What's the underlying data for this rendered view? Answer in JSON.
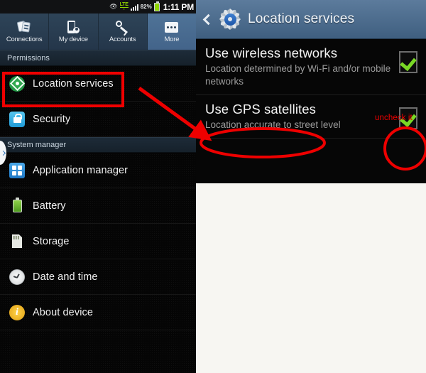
{
  "left_phone": {
    "status_bar": {
      "eye_icon": "eye-icon",
      "network_type": "LTE",
      "signal_icon": "signal-bars-icon",
      "battery_percent": "82%",
      "battery_icon": "battery-icon",
      "clock": "1:11 PM"
    },
    "tabs": [
      {
        "label": "Connections",
        "icon": "connections-icon",
        "selected": false
      },
      {
        "label": "My device",
        "icon": "my-device-icon",
        "selected": false
      },
      {
        "label": "Accounts",
        "icon": "accounts-key-icon",
        "selected": false
      },
      {
        "label": "More",
        "icon": "more-dots-icon",
        "selected": true
      }
    ],
    "sections": [
      {
        "header": "Permissions",
        "items": [
          {
            "label": "Location services",
            "icon": "location-crosshair-icon",
            "highlighted": true
          },
          {
            "label": "Security",
            "icon": "lock-icon",
            "highlighted": false
          }
        ]
      },
      {
        "header": "System manager",
        "items": [
          {
            "label": "Application manager",
            "icon": "app-grid-icon",
            "highlighted": false
          },
          {
            "label": "Battery",
            "icon": "battery-icon",
            "highlighted": false
          },
          {
            "label": "Storage",
            "icon": "sd-card-icon",
            "highlighted": false
          },
          {
            "label": "Date and time",
            "icon": "clock-icon",
            "highlighted": false
          },
          {
            "label": "About device",
            "icon": "info-icon",
            "highlighted": false
          }
        ]
      }
    ],
    "drawer_handle_icon": "chevron-right-icon"
  },
  "right_phone": {
    "header": {
      "back_icon": "back-chevron-icon",
      "gear_icon": "settings-gear-icon",
      "title": "Location services"
    },
    "settings": [
      {
        "title": "Use wireless networks",
        "subtitle": "Location determined by Wi-Fi and/or mobile networks",
        "checked": true,
        "checkbox_icon": "checkbox-checked-icon"
      },
      {
        "title": "Use GPS satellites",
        "subtitle": "Location accurate to street level",
        "checked": true,
        "checkbox_icon": "checkbox-checked-icon"
      }
    ]
  },
  "annotations": {
    "uncheck_label": "uncheck it",
    "red_color": "#ee0000",
    "box_target": "Location services",
    "arrow_target": "Use GPS satellites",
    "ellipse_target": "Use GPS satellites",
    "circle_target": "gps-checkbox"
  },
  "colors": {
    "accent_blue": "#4f7397",
    "header_blue": "#5c7b9c",
    "check_green": "#79d825",
    "annotation_red": "#ee0000",
    "panel_black": "#050505"
  }
}
